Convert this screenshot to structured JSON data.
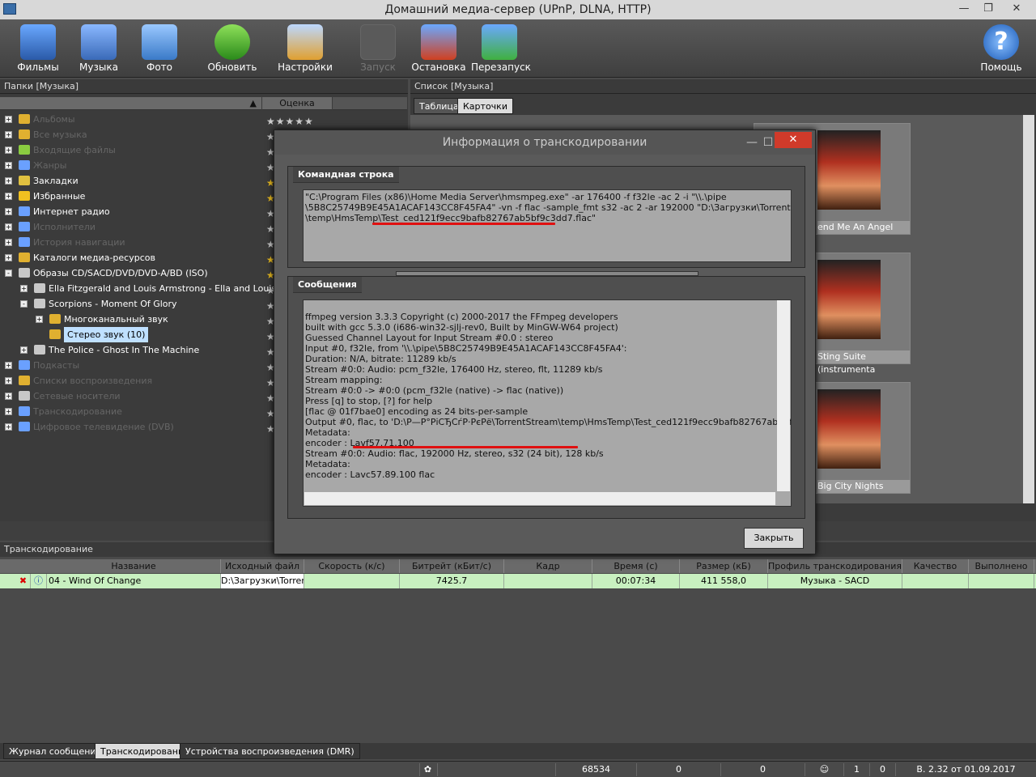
{
  "window": {
    "title": "Домашний медиа-сервер (UPnP, DLNA, HTTP)"
  },
  "toolbar": {
    "items": [
      {
        "label": "Фильмы",
        "icon": "films-icon"
      },
      {
        "label": "Музыка",
        "icon": "music-icon"
      },
      {
        "label": "Фото",
        "icon": "photo-icon"
      },
      {
        "label": "Обновить",
        "icon": "refresh-icon"
      },
      {
        "label": "Настройки",
        "icon": "settings-icon"
      },
      {
        "label": "Запуск",
        "icon": "start-icon",
        "disabled": true
      },
      {
        "label": "Остановка",
        "icon": "stop-icon"
      },
      {
        "label": "Перезапуск",
        "icon": "restart-icon"
      },
      {
        "label": "Помощь",
        "icon": "help-icon"
      }
    ]
  },
  "left": {
    "header": "Папки [Музыка]",
    "rating_col": "Оценка",
    "tree": [
      {
        "label": "Альбомы",
        "dim": true
      },
      {
        "label": "Все музыка",
        "dim": true
      },
      {
        "label": "Входящие файлы",
        "dim": true
      },
      {
        "label": "Жанры",
        "dim": true
      },
      {
        "label": "Закладки",
        "dim": false
      },
      {
        "label": "Избранные",
        "dim": false
      },
      {
        "label": "Интернет радио",
        "dim": false
      },
      {
        "label": "Исполнители",
        "dim": true
      },
      {
        "label": "История навигации",
        "dim": true
      },
      {
        "label": "Каталоги медиа-ресурсов",
        "dim": false
      },
      {
        "label": "Образы CD/SACD/DVD/DVD-A/BD (ISO)",
        "dim": false
      },
      {
        "label": "Ella Fitzgerald and Louis Armstrong - Ella and Louis",
        "dim": false
      },
      {
        "label": "Scorpions - Moment Of Glory",
        "dim": false
      },
      {
        "label": "Многоканальный звук",
        "dim": false
      },
      {
        "label": "Стерео звук (10)",
        "dim": false
      },
      {
        "label": "The Police - Ghost In The Machine",
        "dim": false
      },
      {
        "label": "Подкасты",
        "dim": true
      },
      {
        "label": "Списки воспроизведения",
        "dim": true
      },
      {
        "label": "Сетевые носители",
        "dim": true
      },
      {
        "label": "Транскодирование",
        "dim": true
      },
      {
        "label": "Цифровое телевидение (DVB)",
        "dim": true
      }
    ]
  },
  "right": {
    "header": "Список [Музыка]",
    "tabs": [
      "Таблица",
      "Карточки"
    ],
    "cards": [
      "end Me An Angel",
      "Sting Suite (instrumenta",
      "Big City Nights"
    ]
  },
  "dialog": {
    "title": "Информация о транскодировании",
    "cmd_header": "Командная строка",
    "cmd_lines": [
      "\"C:\\Program Files (x86)\\Home Media Server\\hmsmpeg.exe\" -ar 176400 -f f32le -ac 2 -i \"\\\\.\\pipe",
      "\\5B8C25749B9E45A1ACAF143CC8F45FA4\" -vn -f flac -sample_fmt s32 -ac 2 -ar 192000 \"D:\\Загрузки\\TorrentStream",
      "\\temp\\HmsTemp\\Test_ced121f9ecc9bafb82767ab5bf9c3dd7.flac\""
    ],
    "msg_header": "Сообщения",
    "msg_lines": [
      "ffmpeg version 3.3.3 Copyright (c) 2000-2017 the FFmpeg developers",
      "built with gcc 5.3.0 (i686-win32-sjlj-rev0, Built by MinGW-W64 project)",
      "Guessed Channel Layout for Input Stream #0.0 : stereo",
      "Input #0, f32le, from '\\\\.\\pipe\\5B8C25749B9E45A1ACAF143CC8F45FA4':",
      "Duration: N/A, bitrate: 11289 kb/s",
      "Stream #0:0: Audio: pcm_f32le, 176400 Hz, stereo, flt, 11289 kb/s",
      "Stream mapping:",
      "Stream #0:0 -> #0:0 (pcm_f32le (native) -> flac (native))",
      "Press [q] to stop, [?] for help",
      "[flac @ 01f7bae0] encoding as 24 bits-per-sample",
      "Output #0, flac, to 'D:\\Р—Р°РіСЂСѓР·РєРё\\TorrentStream\\temp\\HmsTemp\\Test_ced121f9ecc9bafb82767ab5bf9c3dd7.fla",
      "Metadata:",
      "encoder        : Lavf57.71.100",
      "Stream #0:0: Audio: flac, 192000 Hz, stereo, s32 (24 bit), 128 kb/s",
      "Metadata:",
      "encoder        : Lavc57.89.100 flac"
    ],
    "close_label": "Закрыть"
  },
  "transcoding": {
    "header": "Транскодирование",
    "columns": [
      "Название",
      "Исходный файл",
      "Скорость (к/с)",
      "Битрейт (кБит/с)",
      "Кадр",
      "Время (с)",
      "Размер (кБ)",
      "Профиль транскодирования",
      "Качество",
      "Выполнено"
    ],
    "row": {
      "name": "04 - Wind Of Change",
      "source": "D:\\Загрузки\\Torrent",
      "speed": "",
      "bitrate": "7425.7",
      "frame": "",
      "time": "00:07:34",
      "size": "411 558,0",
      "profile": "Музыка - SACD",
      "quality": "",
      "done": ""
    }
  },
  "bottom_tabs": [
    "Журнал сообщений",
    "Транскодирование",
    "Устройства воспроизведения (DMR)"
  ],
  "status": {
    "count": "68534",
    "v1": "0",
    "v2": "0",
    "v3": "1",
    "v4": "0",
    "version": "В. 2.32 от 01.09.2017"
  }
}
